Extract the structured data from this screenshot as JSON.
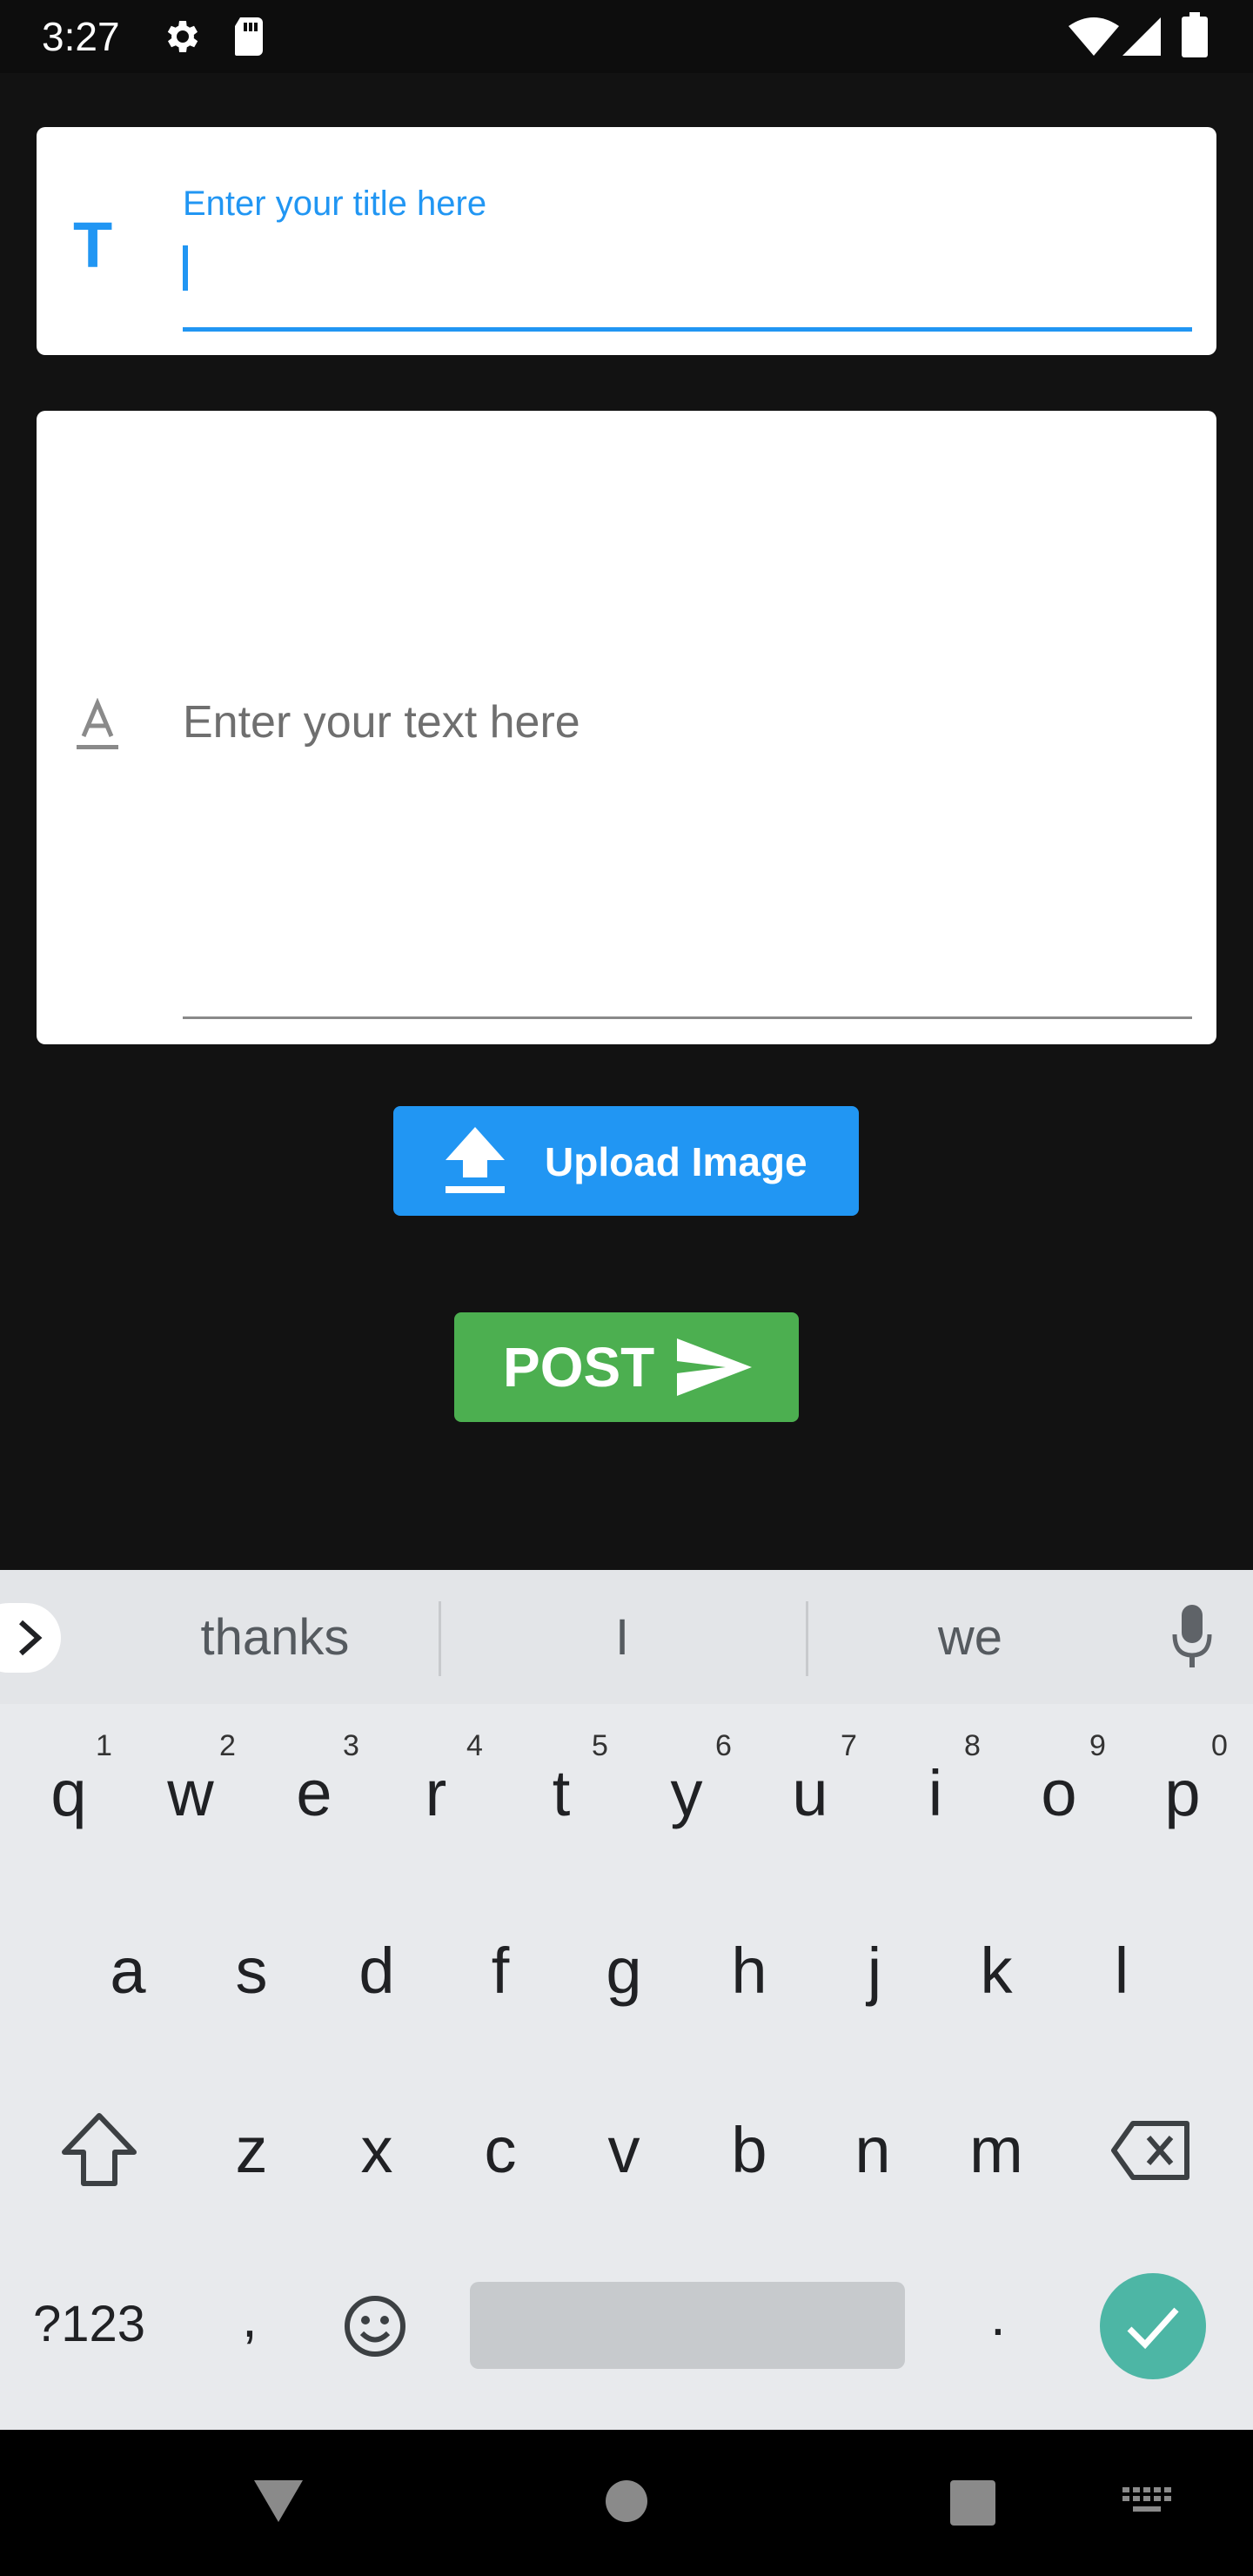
{
  "status_bar": {
    "time": "3:27",
    "icons": [
      "settings-icon",
      "sd-card-icon",
      "wifi-icon",
      "signal-icon",
      "battery-icon"
    ]
  },
  "title_field": {
    "icon": "T",
    "label": "Enter your title here",
    "value": ""
  },
  "text_field": {
    "icon": "text-format-icon",
    "placeholder": "Enter your text here"
  },
  "upload_button": {
    "label": "Upload Image",
    "icon": "upload-icon"
  },
  "post_button": {
    "label": "POST",
    "icon": "send-icon"
  },
  "keyboard": {
    "suggestions": [
      "thanks",
      "I",
      "we"
    ],
    "row1": [
      "q",
      "w",
      "e",
      "r",
      "t",
      "y",
      "u",
      "i",
      "o",
      "p"
    ],
    "row1_hints": [
      "1",
      "2",
      "3",
      "4",
      "5",
      "6",
      "7",
      "8",
      "9",
      "0"
    ],
    "row2": [
      "a",
      "s",
      "d",
      "f",
      "g",
      "h",
      "j",
      "k",
      "l"
    ],
    "row3": [
      "z",
      "x",
      "c",
      "v",
      "b",
      "n",
      "m"
    ],
    "symbols_key": "?123",
    "comma_key": ",",
    "period_key": "."
  },
  "colors": {
    "accent_blue": "#2196f3",
    "post_green": "#4caf50",
    "enter_teal": "#4db6a5",
    "background": "#121212"
  }
}
